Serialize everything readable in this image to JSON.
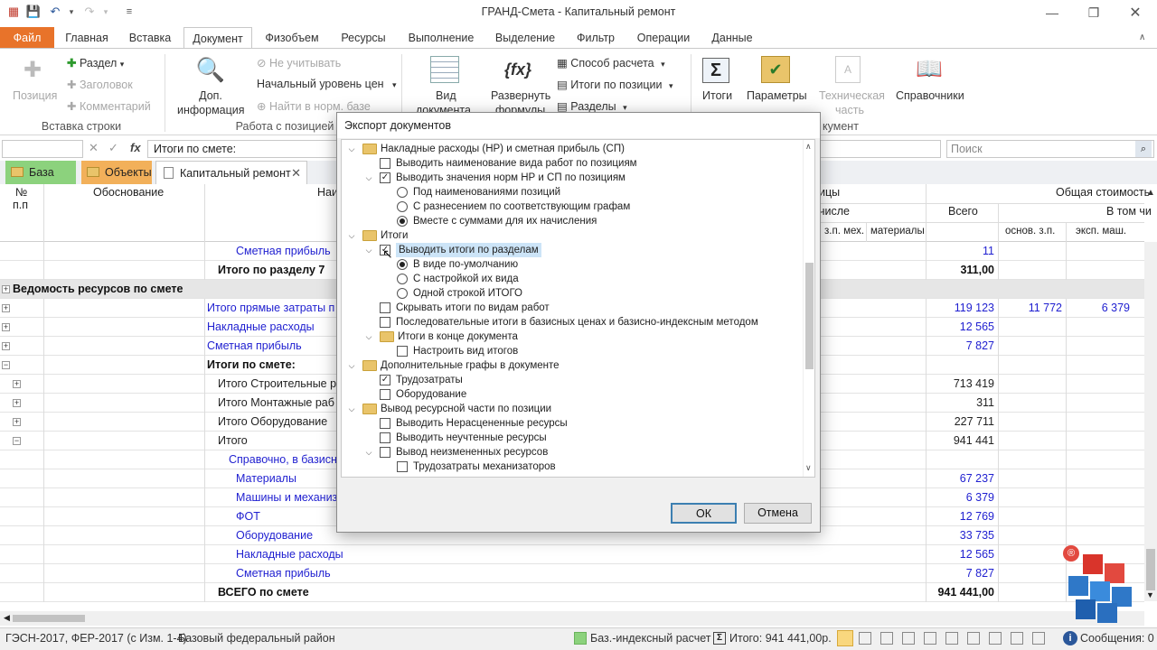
{
  "window": {
    "title": "ГРАНД-Смета - Капитальный ремонт"
  },
  "menu": [
    "Файл",
    "Главная",
    "Вставка",
    "Документ",
    "Физобъем",
    "Ресурсы",
    "Выполнение",
    "Выделение",
    "Фильтр",
    "Операции",
    "Данные"
  ],
  "ribbon": {
    "position": "Позиция",
    "section": "Раздел",
    "heading": "Заголовок",
    "comment": "Комментарий",
    "group_insert": "Вставка строки",
    "dop_info_1": "Доп.",
    "dop_info_2": "информация",
    "ignore": "Не учитывать",
    "price_level": "Начальный уровень цен",
    "find_norm": "Найти в норм. базе",
    "group_positions": "Работа с позицией",
    "view_doc_1": "Вид",
    "view_doc_2": "документа",
    "expand_1": "Развернуть",
    "expand_2": "формулы",
    "calc_method": "Способ расчета",
    "totals_pos": "Итоги по позиции",
    "sections": "Разделы",
    "totals": "Итоги",
    "params": "Параметры",
    "tech_1": "Техническая",
    "tech_2": "часть",
    "refs": "Справочники",
    "group_doc": "кумент"
  },
  "formula": {
    "cell_ref": "",
    "value": "Итоги по смете:",
    "search_placeholder": "Поиск"
  },
  "tabs": {
    "base": "База",
    "objects": "Объекты",
    "doc": "Капитальный ремонт"
  },
  "grid": {
    "headers": {
      "num": "№",
      "num2": "п.п",
      "basis": "Обоснование",
      "name": "Наим",
      "units_tail": "ицы",
      "total_cost": "Общая стоимость",
      "incl": "числе",
      "mach": "з.п. мех.",
      "materials": "материалы",
      "all": "Всего",
      "in_that": "В том чи",
      "osn": "основ. з.п.",
      "eksp": "эксп. маш."
    },
    "rows": [
      {
        "name": "Сметная прибыль",
        "style": "blue",
        "indent": 261,
        "total": "11",
        "osn": "",
        "eksp": ""
      },
      {
        "name": "Итого по разделу 7",
        "style": "bold",
        "indent": 241,
        "total": "311,00",
        "osn": "",
        "eksp": ""
      },
      {
        "name": "Ведомость ресурсов по смете",
        "style": "band",
        "indent": 14,
        "total": "",
        "osn": "",
        "eksp": ""
      },
      {
        "name": "Итого прямые затраты п",
        "style": "blue",
        "indent": 229,
        "total": "119 123",
        "osn": "11 772",
        "eksp": "6 379"
      },
      {
        "name": "Накладные расходы",
        "style": "blue",
        "indent": 229,
        "total": "12 565",
        "osn": "",
        "eksp": ""
      },
      {
        "name": "Сметная прибыль",
        "style": "blue",
        "indent": 229,
        "total": "7 827",
        "osn": "",
        "eksp": ""
      },
      {
        "name": "Итоги по смете:",
        "style": "bold",
        "indent": 229,
        "total": "",
        "osn": "",
        "eksp": ""
      },
      {
        "name": "Итого Строительные р",
        "style": "plain",
        "indent": 241,
        "total": "713 419",
        "osn": "",
        "eksp": ""
      },
      {
        "name": "Итого Монтажные раб",
        "style": "plain",
        "indent": 241,
        "total": "311",
        "osn": "",
        "eksp": ""
      },
      {
        "name": "Итого Оборудование",
        "style": "plain",
        "indent": 241,
        "total": "227 711",
        "osn": "",
        "eksp": ""
      },
      {
        "name": "Итого",
        "style": "plain",
        "indent": 241,
        "total": "941 441",
        "osn": "",
        "eksp": ""
      },
      {
        "name": "Справочно, в базисн",
        "style": "blue",
        "indent": 253,
        "total": "",
        "osn": "",
        "eksp": ""
      },
      {
        "name": "Материалы",
        "style": "blue",
        "indent": 261,
        "total": "67 237",
        "osn": "",
        "eksp": ""
      },
      {
        "name": "Машины и механиз",
        "style": "blue",
        "indent": 261,
        "total": "6 379",
        "osn": "",
        "eksp": ""
      },
      {
        "name": "ФОТ",
        "style": "blue",
        "indent": 261,
        "total": "12 769",
        "osn": "",
        "eksp": ""
      },
      {
        "name": "Оборудование",
        "style": "blue",
        "indent": 261,
        "total": "33 735",
        "osn": "",
        "eksp": ""
      },
      {
        "name": "Накладные расходы",
        "style": "blue",
        "indent": 261,
        "total": "12 565",
        "osn": "",
        "eksp": ""
      },
      {
        "name": "Сметная прибыль",
        "style": "blue",
        "indent": 261,
        "total": "7 827",
        "osn": "",
        "eksp": ""
      },
      {
        "name": "ВСЕГО по смете",
        "style": "bold",
        "indent": 241,
        "total": "941 441,00",
        "osn": "",
        "eksp": ""
      }
    ]
  },
  "dialog": {
    "title": "Экспорт документов",
    "ok": "ОК",
    "cancel": "Отмена",
    "tree": [
      {
        "level": 0,
        "kind": "folder",
        "chev": "v",
        "label": "Накладные расходы (НР) и сметная прибыль (СП)"
      },
      {
        "level": 1,
        "kind": "check",
        "checked": false,
        "label": "Выводить наименование вида работ по позициям"
      },
      {
        "level": 1,
        "kind": "check",
        "chev": "v",
        "checked": true,
        "label": "Выводить значения норм НР и СП по позициям"
      },
      {
        "level": 2,
        "kind": "radio",
        "checked": false,
        "label": "Под наименованиями позиций"
      },
      {
        "level": 2,
        "kind": "radio",
        "checked": false,
        "label": "С разнесением по соответствующим графам"
      },
      {
        "level": 2,
        "kind": "radio",
        "checked": true,
        "label": "Вместе с суммами для их начисления"
      },
      {
        "level": 0,
        "kind": "folder",
        "chev": "v",
        "label": "Итоги"
      },
      {
        "level": 1,
        "kind": "check",
        "chev": "v",
        "checked": true,
        "selected": true,
        "label": "Выводить итоги по разделам"
      },
      {
        "level": 2,
        "kind": "radio",
        "checked": true,
        "label": "В виде по-умолчанию"
      },
      {
        "level": 2,
        "kind": "radio",
        "checked": false,
        "label": "С настройкой их вида"
      },
      {
        "level": 2,
        "kind": "radio",
        "checked": false,
        "label": "Одной строкой ИТОГО"
      },
      {
        "level": 1,
        "kind": "check",
        "checked": false,
        "label": "Скрывать итоги по видам работ"
      },
      {
        "level": 1,
        "kind": "check",
        "checked": false,
        "label": "Последовательные итоги в базисных ценах и базисно-индексным методом"
      },
      {
        "level": 1,
        "kind": "folder",
        "chev": "v",
        "label": "Итоги в конце документа"
      },
      {
        "level": 2,
        "kind": "check",
        "checked": false,
        "label": "Настроить вид итогов"
      },
      {
        "level": 0,
        "kind": "folder",
        "chev": "v",
        "label": "Дополнительные графы в документе"
      },
      {
        "level": 1,
        "kind": "check",
        "checked": true,
        "label": "Трудозатраты"
      },
      {
        "level": 1,
        "kind": "check",
        "checked": false,
        "label": "Оборудование"
      },
      {
        "level": 0,
        "kind": "folder",
        "chev": "v",
        "label": "Вывод ресурсной части по позиции"
      },
      {
        "level": 1,
        "kind": "check",
        "checked": false,
        "label": "Выводить Нерасцененные ресурсы"
      },
      {
        "level": 1,
        "kind": "check",
        "checked": false,
        "label": "Выводить неучтенные ресурсы"
      },
      {
        "level": 1,
        "kind": "check",
        "chev": "v",
        "checked": false,
        "label": "Вывод неизмененных ресурсов"
      },
      {
        "level": 2,
        "kind": "check",
        "checked": false,
        "label": "Трудозатраты механизаторов"
      }
    ]
  },
  "status": {
    "norms": "ГЭСН-2017, ФЕР-2017 (с Изм. 1-4)",
    "region": "Базовый федеральный район",
    "method": "Баз.-индексный расчет",
    "total": "Итого: 941 441,00р.",
    "messages": "Сообщения: 0"
  },
  "colors": {
    "accent": "#e8732a",
    "link": "#1f1fd0",
    "checked_fill": "#8cd27d"
  }
}
